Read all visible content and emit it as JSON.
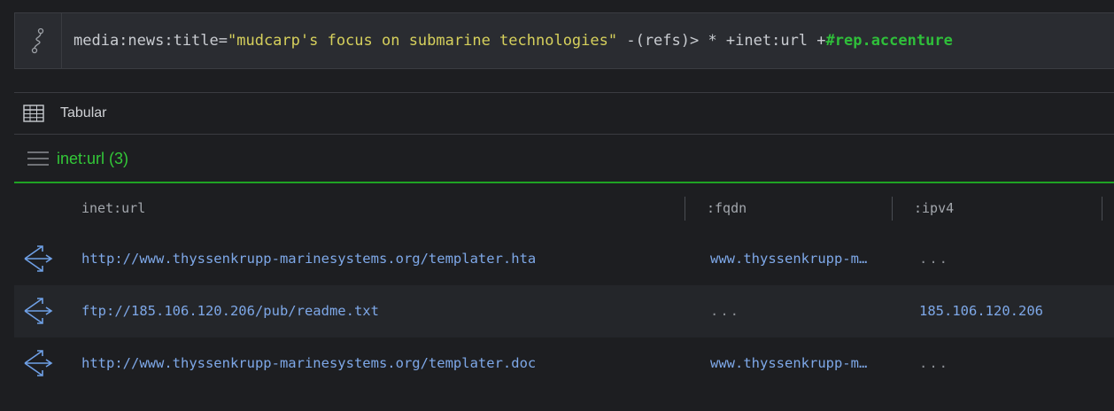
{
  "query": {
    "prefix": "media:news:title=",
    "string": "\"mudcarp's focus on submarine technologies\"",
    "middle": " -(refs)> * +inet:url +",
    "tag": "#rep.accenture"
  },
  "view_tab": {
    "label": "Tabular"
  },
  "form": {
    "title": "inet:url (3)"
  },
  "table": {
    "columns": [
      "inet:url",
      ":fqdn",
      ":ipv4"
    ],
    "rows": [
      {
        "url": "http://www.thyssenkrupp-marinesystems.org/templater.hta",
        "fqdn": "www.thyssenkrupp-m…",
        "ipv4": "..."
      },
      {
        "url": "ftp://185.106.120.206/pub/readme.txt",
        "fqdn": "...",
        "ipv4": "185.106.120.206"
      },
      {
        "url": "http://www.thyssenkrupp-marinesystems.org/templater.doc",
        "fqdn": "www.thyssenkrupp-m…",
        "ipv4": "..."
      }
    ]
  },
  "icons": {
    "query": "query-pipeline-icon",
    "tab": "table-grid-icon",
    "menu": "hamburger-menu-icon",
    "row": "node-link-icon"
  },
  "colors": {
    "background": "#1d1e21",
    "accent_green": "#33c838",
    "link_blue": "#7ea8e8",
    "string_yellow": "#d6d05c"
  }
}
